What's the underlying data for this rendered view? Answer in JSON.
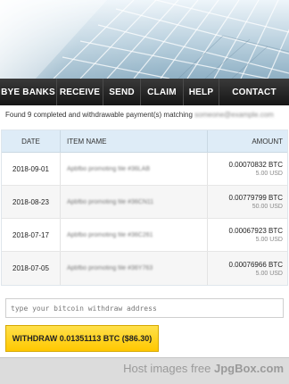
{
  "nav": {
    "items": [
      "BYE BANKS",
      "RECEIVE",
      "SEND",
      "CLAIM",
      "HELP",
      "CONTACT"
    ]
  },
  "summary": {
    "text": "Found 9 completed and withdrawable payment(s) matching",
    "email": "someone@example.com"
  },
  "table": {
    "headers": {
      "date": "DATE",
      "item": "ITEM NAME",
      "amount": "AMOUNT"
    },
    "rows": [
      {
        "date": "2018-09-01",
        "item": "Apbfbo promoting file #36LAB",
        "btc": "0.00070832 BTC",
        "usd": "5.00 USD"
      },
      {
        "date": "2018-08-23",
        "item": "Apbfbo promoting file #36CN11",
        "btc": "0.00779799 BTC",
        "usd": "50.00 USD"
      },
      {
        "date": "2018-07-17",
        "item": "Apbfbo promoting file #36C261",
        "btc": "0.00067923 BTC",
        "usd": "5.00 USD"
      },
      {
        "date": "2018-07-05",
        "item": "Apbfbo promoting file #36Y763",
        "btc": "0.00076966 BTC",
        "usd": "5.00 USD"
      }
    ]
  },
  "withdraw": {
    "placeholder": "type your bitcoin withdraw address",
    "button_label": "WITHDRAW 0.01351113 BTC ($86.30)"
  },
  "watermark": {
    "prefix": "Host images free",
    "brand": "JpgBox.com"
  },
  "colors": {
    "nav_bg": "#1f1f1f",
    "header_bg": "#deecf7",
    "button_bg": "#ffd21f"
  }
}
